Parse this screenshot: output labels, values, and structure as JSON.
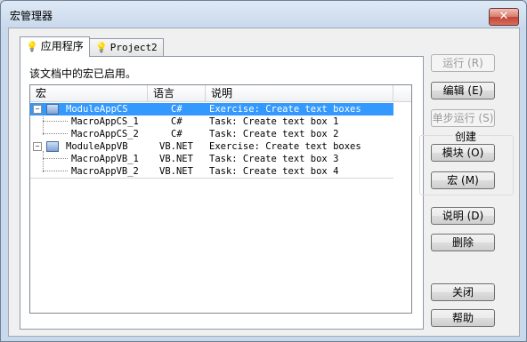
{
  "window": {
    "title": "宏管理器",
    "close_glyph": "✕"
  },
  "tabs": [
    {
      "label": "应用程序",
      "icon": "bulb-icon"
    },
    {
      "label": "Project2",
      "icon": "bulb-icon"
    }
  ],
  "panel": {
    "description": "该文档中的宏已启用。"
  },
  "list": {
    "columns": [
      "宏",
      "语言",
      "说明"
    ],
    "rows": [
      {
        "name": "ModuleAppCS",
        "language": "C#",
        "description": "Exercise: Create text boxes",
        "kind": "module",
        "expander": "−"
      },
      {
        "name": "MacroAppCS_1",
        "language": "C#",
        "description": "Task: Create text box 1",
        "kind": "macro"
      },
      {
        "name": "MacroAppCS_2",
        "language": "C#",
        "description": "Task: Create text box 2",
        "kind": "macro"
      },
      {
        "name": "ModuleAppVB",
        "language": "VB.NET",
        "description": "Exercise: Create text boxes",
        "kind": "module",
        "expander": "−"
      },
      {
        "name": "MacroAppVB_1",
        "language": "VB.NET",
        "description": "Task: Create text box 3",
        "kind": "macro"
      },
      {
        "name": "MacroAppVB_2",
        "language": "VB.NET",
        "description": "Task: Create text box 4",
        "kind": "macro"
      }
    ],
    "selected_row": 0
  },
  "buttons": {
    "run": "运行 (R)",
    "edit": "编辑 (E)",
    "step": "单步运行 (S)",
    "create_group": "创建",
    "module": "模块 (O)",
    "macro": "宏 (M)",
    "help_desc": "说明 (D)",
    "delete": "删除",
    "close": "关闭",
    "help": "帮助"
  }
}
